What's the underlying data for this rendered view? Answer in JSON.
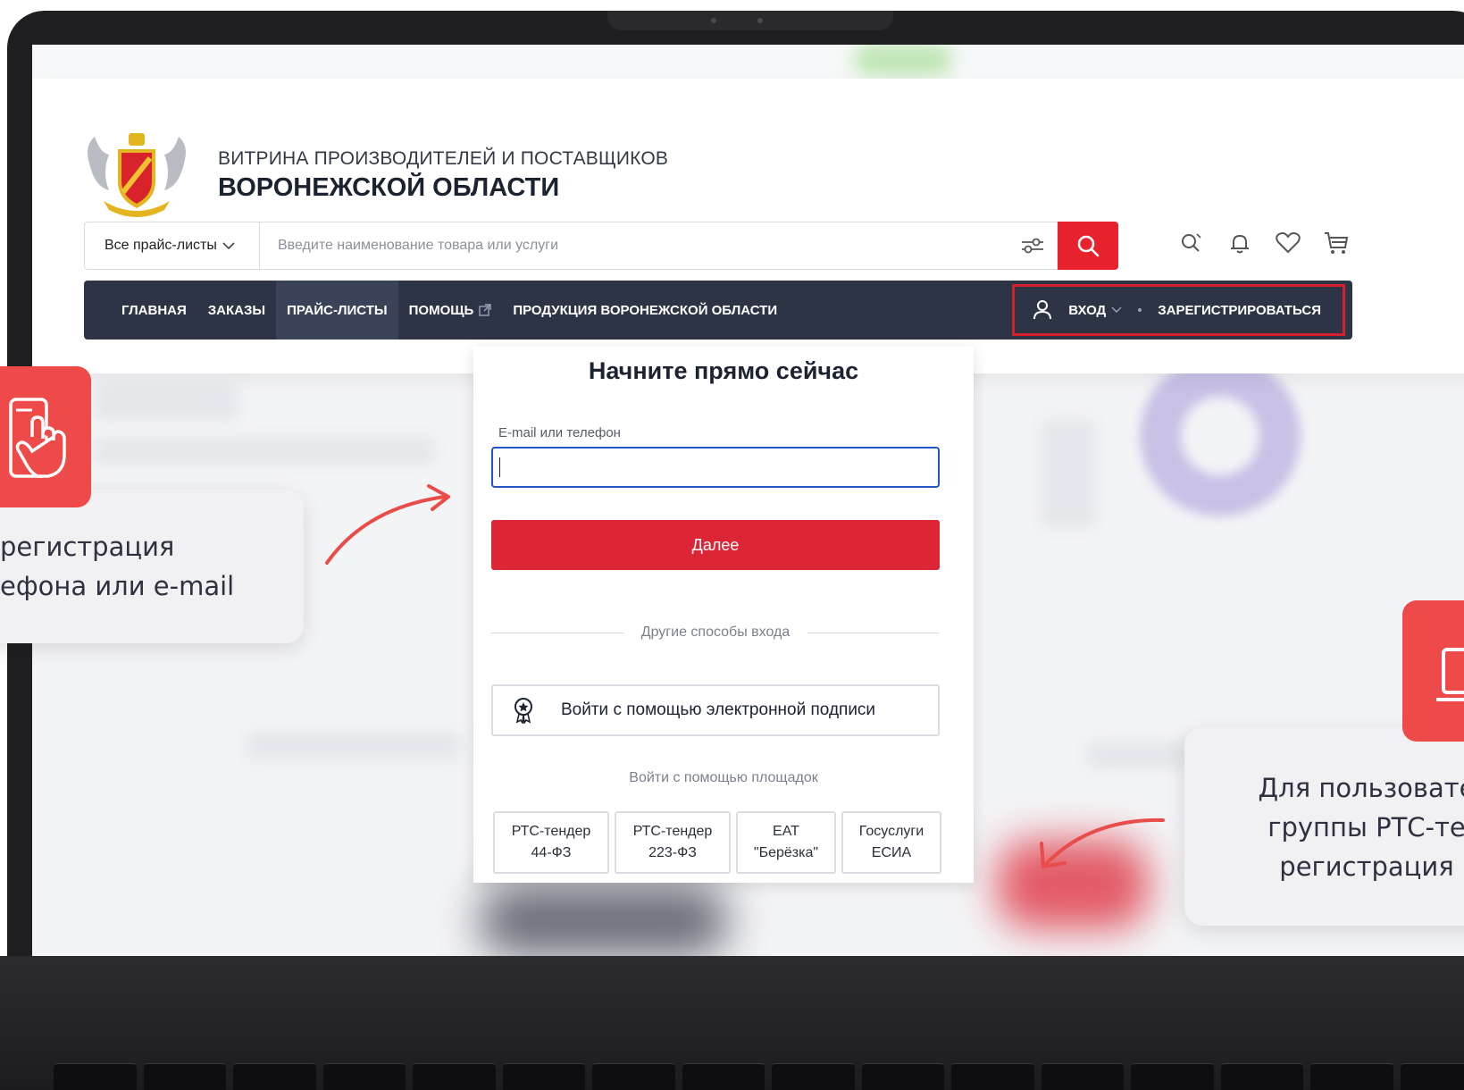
{
  "site": {
    "title_top": "ВИТРИНА ПРОИЗВОДИТЕЛЕЙ И ПОСТАВЩИКОВ",
    "title_bottom": "ВОРОНЕЖСКОЙ ОБЛАСТИ"
  },
  "search": {
    "catalog_label": "Все прайс-листы",
    "placeholder": "Введите наименование товара или услуги"
  },
  "header_icons": [
    "search-history-icon",
    "bell-icon",
    "heart-icon",
    "cart-icon"
  ],
  "nav": {
    "items": [
      {
        "label": "ГЛАВНАЯ"
      },
      {
        "label": "ЗАКАЗЫ"
      },
      {
        "label": "ПРАЙС-ЛИСТЫ"
      },
      {
        "label": "ПОМОЩЬ"
      },
      {
        "label": "ПРОДУКЦИЯ ВОРОНЕЖСКОЙ ОБЛАСТИ"
      }
    ],
    "login_label": "ВХОД",
    "register_label": "ЗАРЕГИСТРИРОВАТЬСЯ"
  },
  "modal": {
    "title": "Начните прямо сейчас",
    "field_label": "E-mail или телефон",
    "field_value": "",
    "next_label": "Далее",
    "other_ways_label": "Другие способы входа",
    "esign_label": "Войти с помощью электронной подписи",
    "platforms_label": "Войти с помощью площадок",
    "platforms": [
      {
        "line1": "РТС-тендер",
        "line2": "44-ФЗ"
      },
      {
        "line1": "РТС-тендер",
        "line2": "223-ФЗ"
      },
      {
        "line1": "ЕАТ",
        "line2": "\"Берёзка\""
      },
      {
        "line1": "Госуслуги",
        "line2": "ЕСИА"
      }
    ]
  },
  "callouts": {
    "left": {
      "line1": "регистрация",
      "line2": "ефона или e-mail"
    },
    "right": {
      "line1": "Для пользовате",
      "line2": "группы РТС-те",
      "line3": "регистрация"
    }
  },
  "colors": {
    "accent_red": "#e8222d",
    "nav_dark": "#2c3446",
    "focus_blue": "#2255c4",
    "badge_red": "#ee4a49"
  }
}
